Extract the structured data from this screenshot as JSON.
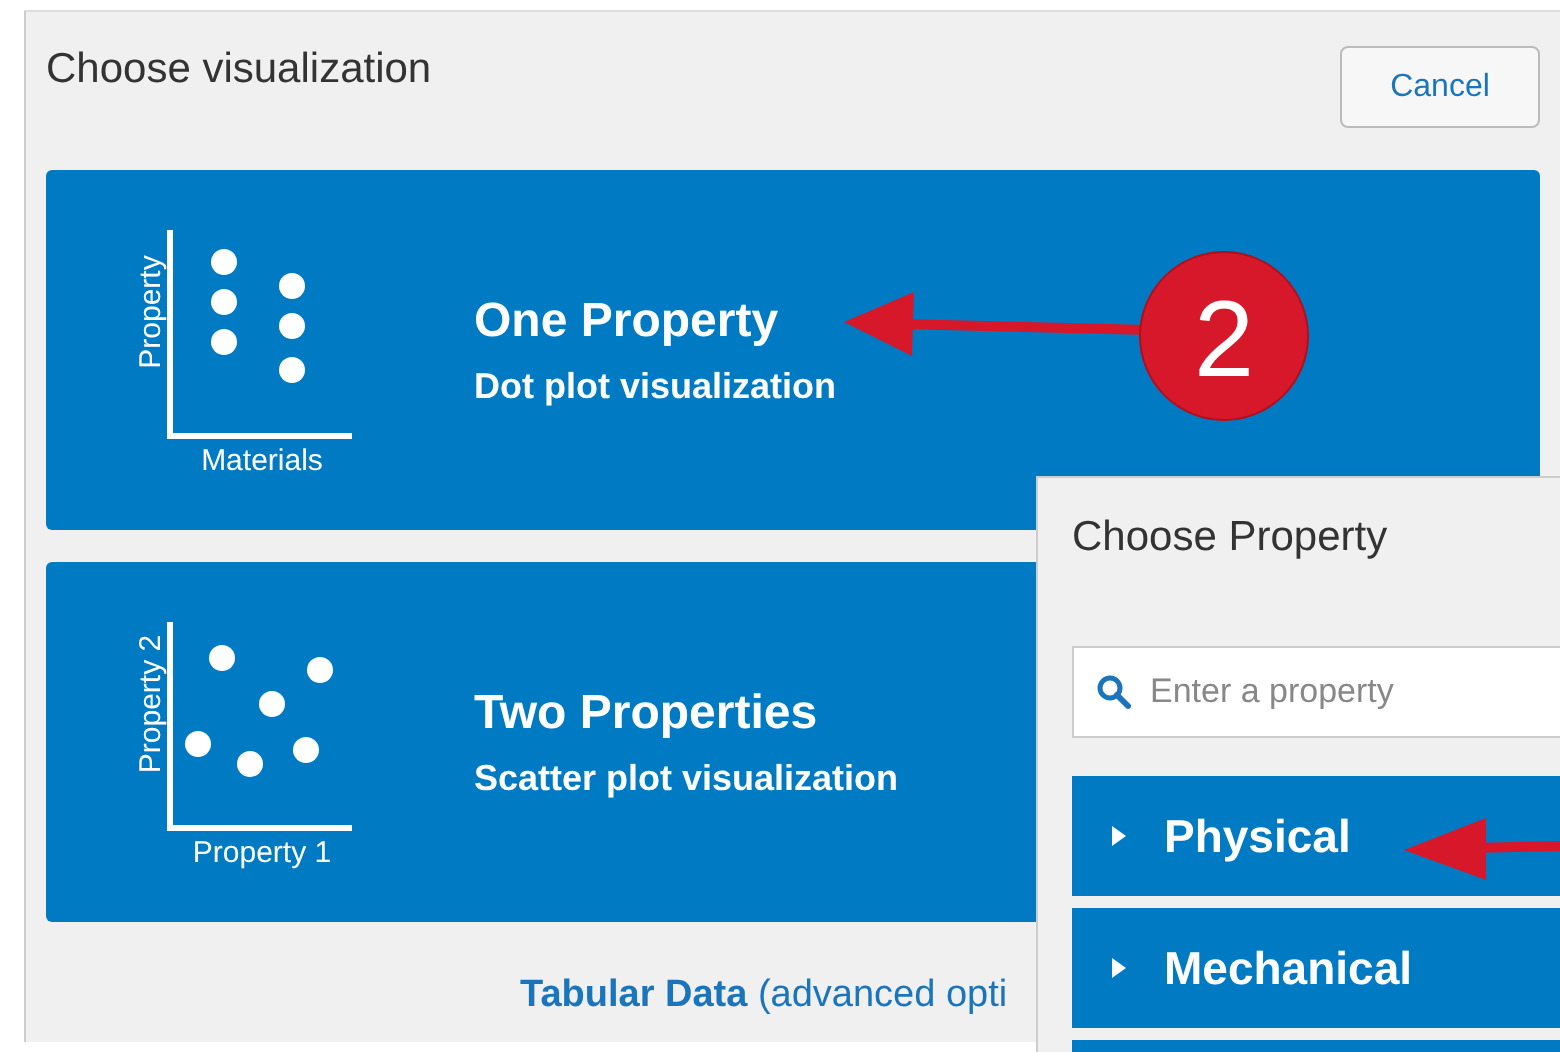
{
  "dialog": {
    "title": "Choose visualization",
    "cancel_button": "Cancel"
  },
  "options": [
    {
      "title": "One Property",
      "subtitle": "Dot plot visualization",
      "chart": {
        "kind": "dot",
        "y_label": "Property",
        "x_label": "Materials"
      }
    },
    {
      "title": "Two Properties",
      "subtitle": "Scatter plot visualization",
      "chart": {
        "kind": "scatter",
        "y_label": "Property 2",
        "x_label": "Property 1"
      }
    }
  ],
  "tabular_link": "**Tabular Data** (advanced opti",
  "property_panel": {
    "title": "Choose Property",
    "search": {
      "placeholder": "Enter a property"
    },
    "categories": [
      {
        "label": "Physical",
        "expanded": false
      },
      {
        "label": "Mechanical",
        "expanded": false
      }
    ]
  },
  "annotation": {
    "step_badge": "2"
  }
}
